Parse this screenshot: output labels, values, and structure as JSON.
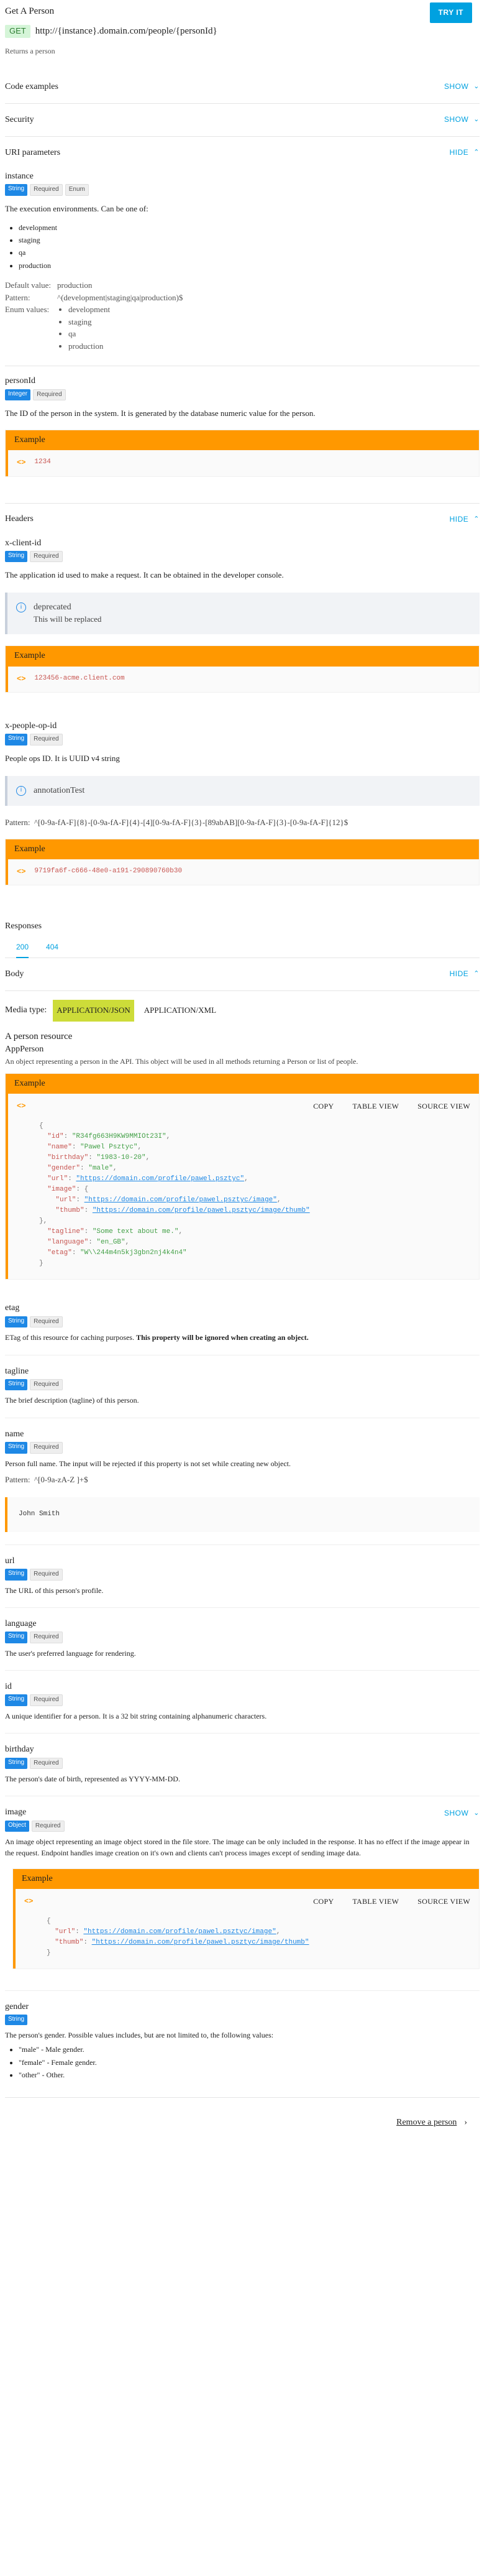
{
  "header": {
    "title": "Get A Person",
    "try_label": "TRY IT",
    "method": "GET",
    "url": "http://{instance}.domain.com/people/{personId}",
    "summary": "Returns a person"
  },
  "sections": {
    "code_examples": "Code examples",
    "security": "Security",
    "uri_parameters": "URI parameters",
    "show": "SHOW",
    "hide": "HIDE",
    "headers": "Headers",
    "responses": "Responses",
    "body": "Body"
  },
  "uri_params": {
    "instance": {
      "name": "instance",
      "type": "String",
      "required": "Required",
      "enum": "Enum",
      "desc": "The execution environments. Can be one of:",
      "values": [
        "development",
        "staging",
        "qa",
        "production"
      ],
      "default_label": "Default value:",
      "default_value": "production",
      "pattern_label": "Pattern:",
      "pattern_value": "^(development|staging|qa|production)$",
      "enum_label": "Enum values:",
      "enum_values": [
        "development",
        "staging",
        "qa",
        "production"
      ]
    },
    "personId": {
      "name": "personId",
      "type": "Integer",
      "required": "Required",
      "desc": "The ID of the person in the system. It is generated by the database numeric value for the person.",
      "example_label": "Example",
      "example_value": "1234"
    }
  },
  "headers": {
    "x_client_id": {
      "name": "x-client-id",
      "type": "String",
      "required": "Required",
      "desc": "The application id used to make a request. It can be obtained in the developer console.",
      "annot_title": "deprecated",
      "annot_desc": "This will be replaced",
      "example_label": "Example",
      "example_value": "123456-acme.client.com"
    },
    "x_people_op_id": {
      "name": "x-people-op-id",
      "type": "String",
      "required": "Required",
      "desc": "People ops ID. It is UUID v4 string",
      "annot_title": "annotationTest",
      "pattern_label": "Pattern:",
      "pattern_value": "^[0-9a-fA-F]{8}-[0-9a-fA-F]{4}-[4][0-9a-fA-F]{3}-[89abAB][0-9a-fA-F]{3}-[0-9a-fA-F]{12}$",
      "example_label": "Example",
      "example_value": "9719fa6f-c666-48e0-a191-290890760b30"
    }
  },
  "responses": {
    "codes": [
      "200",
      "404"
    ]
  },
  "body": {
    "media_label": "Media type:",
    "media_json": "APPLICATION/JSON",
    "media_xml": "APPLICATION/XML",
    "resource_title": "A person resource",
    "resource_type": "AppPerson",
    "resource_desc": "An object representing a person in the API. This object will be used in all methods returning a Person or list of people.",
    "example_label": "Example",
    "copy": "COPY",
    "table_view": "TABLE VIEW",
    "source_view": "SOURCE VIEW",
    "json": [
      {
        "t": "{"
      },
      {
        "k": "\"id\"",
        "v": "\"R34fg663H9KW9MMIOt23I\"",
        "vt": "s"
      },
      {
        "k": "\"name\"",
        "v": "\"Pawel Psztyc\"",
        "vt": "s"
      },
      {
        "k": "\"birthday\"",
        "v": "\"1983-10-20\"",
        "vt": "s"
      },
      {
        "k": "\"gender\"",
        "v": "\"male\"",
        "vt": "s"
      },
      {
        "k": "\"url\"",
        "v": "\"https://domain.com/profile/pawel.psztyc\"",
        "vt": "u"
      },
      {
        "k": "\"image\"",
        "v": "{",
        "vt": "p"
      },
      {
        "k": "  \"url\"",
        "v": "\"https://domain.com/profile/pawel.psztyc/image\"",
        "vt": "u"
      },
      {
        "k": "  \"thumb\"",
        "v": "\"https://domain.com/profile/pawel.psztyc/image/thumb\"",
        "vt": "u"
      },
      {
        "t": "},"
      },
      {
        "k": "\"tagline\"",
        "v": "\"Some text about me.\"",
        "vt": "s"
      },
      {
        "k": "\"language\"",
        "v": "\"en_GB\"",
        "vt": "s"
      },
      {
        "k": "\"etag\"",
        "v": "\"W\\\\244m4n5kj3gbn2nj4k4n4\"",
        "vt": "s"
      },
      {
        "t": "}"
      }
    ]
  },
  "props": [
    {
      "name": "etag",
      "type": "String",
      "required": "Required",
      "desc": "ETag of this resource for caching purposes.",
      "strong": "This property will be ignored when creating an object."
    },
    {
      "name": "tagline",
      "type": "String",
      "required": "Required",
      "desc": "The brief description (tagline) of this person."
    },
    {
      "name": "name",
      "type": "String",
      "required": "Required",
      "desc": "Person full name. The input will be rejected if this property is not set while creating new object.",
      "pattern_label": "Pattern:",
      "pattern_value": "^[0-9a-zA-Z ]+$",
      "example": "John Smith"
    },
    {
      "name": "url",
      "type": "String",
      "required": "Required",
      "desc": "The URL of this person's profile."
    },
    {
      "name": "language",
      "type": "String",
      "required": "Required",
      "desc": "The user's preferred language for rendering."
    },
    {
      "name": "id",
      "type": "String",
      "required": "Required",
      "desc": "A unique identifier for a person. It is a 32 bit string containing alphanumeric characters."
    },
    {
      "name": "birthday",
      "type": "String",
      "required": "Required",
      "desc": "The person's date of birth, represented as YYYY-MM-DD."
    }
  ],
  "image_prop": {
    "name": "image",
    "type": "Object",
    "required": "Required",
    "show": "SHOW",
    "desc": "An image object representing an image object stored in the file store. The image can be only included in the response. It has no effect if the image appear in the request. Endpoint handles image creation on it's own and clients can't process images except of sending image data.",
    "example_label": "Example",
    "json": [
      {
        "t": "{"
      },
      {
        "k": "\"url\"",
        "v": "\"https://domain.com/profile/pawel.psztyc/image\"",
        "vt": "u"
      },
      {
        "k": "\"thumb\"",
        "v": "\"https://domain.com/profile/pawel.psztyc/image/thumb\"",
        "vt": "u"
      },
      {
        "t": "}"
      }
    ]
  },
  "gender_prop": {
    "name": "gender",
    "type": "String",
    "desc": "The person's gender. Possible values includes, but are not limited to, the following values:",
    "values": [
      "\"male\" - Male gender.",
      "\"female\" - Female gender.",
      "\"other\" - Other."
    ]
  },
  "footer": {
    "link": "Remove a person"
  }
}
